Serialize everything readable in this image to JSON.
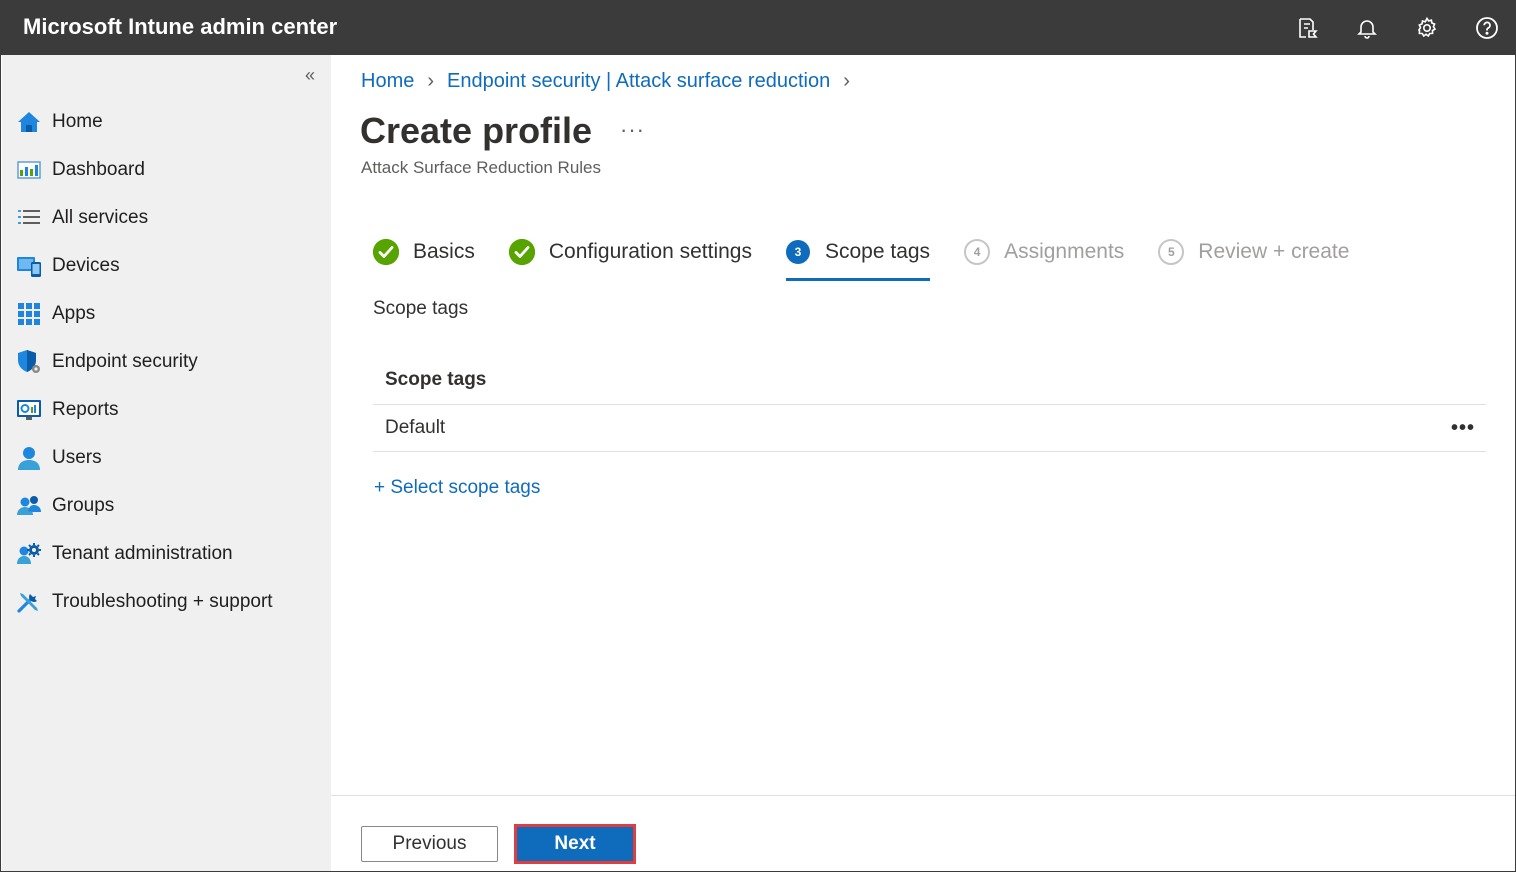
{
  "app": {
    "title": "Microsoft Intune admin center"
  },
  "topbar": {
    "icons": [
      "feedback-icon",
      "notifications-icon",
      "settings-icon",
      "help-icon"
    ]
  },
  "sidebar": {
    "collapse_glyph": "«",
    "items": [
      {
        "label": "Home",
        "icon": "home-icon"
      },
      {
        "label": "Dashboard",
        "icon": "dashboard-icon"
      },
      {
        "label": "All services",
        "icon": "all-services-icon"
      },
      {
        "label": "Devices",
        "icon": "devices-icon"
      },
      {
        "label": "Apps",
        "icon": "apps-icon"
      },
      {
        "label": "Endpoint security",
        "icon": "endpoint-security-icon"
      },
      {
        "label": "Reports",
        "icon": "reports-icon"
      },
      {
        "label": "Users",
        "icon": "users-icon"
      },
      {
        "label": "Groups",
        "icon": "groups-icon"
      },
      {
        "label": "Tenant administration",
        "icon": "tenant-admin-icon"
      },
      {
        "label": "Troubleshooting + support",
        "icon": "troubleshooting-icon"
      }
    ]
  },
  "breadcrumb": {
    "items": [
      "Home",
      "Endpoint security | Attack surface reduction"
    ]
  },
  "page": {
    "title": "Create profile",
    "more": "···",
    "subtitle": "Attack Surface Reduction Rules"
  },
  "wizard": {
    "steps": [
      {
        "num": "",
        "label": "Basics",
        "state": "done"
      },
      {
        "num": "",
        "label": "Configuration settings",
        "state": "done"
      },
      {
        "num": "3",
        "label": "Scope tags",
        "state": "current"
      },
      {
        "num": "4",
        "label": "Assignments",
        "state": "pending"
      },
      {
        "num": "5",
        "label": "Review + create",
        "state": "pending"
      }
    ]
  },
  "scope": {
    "section_label": "Scope tags",
    "table_header": "Scope tags",
    "rows": [
      {
        "name": "Default",
        "more": "•••"
      }
    ],
    "select_link": "+ Select scope tags"
  },
  "footer": {
    "previous_label": "Previous",
    "next_label": "Next"
  },
  "colors": {
    "topbar": "#3b3b3b",
    "accent": "#0f6cbd",
    "success": "#57a300",
    "highlight_border": "#e03e3e"
  }
}
